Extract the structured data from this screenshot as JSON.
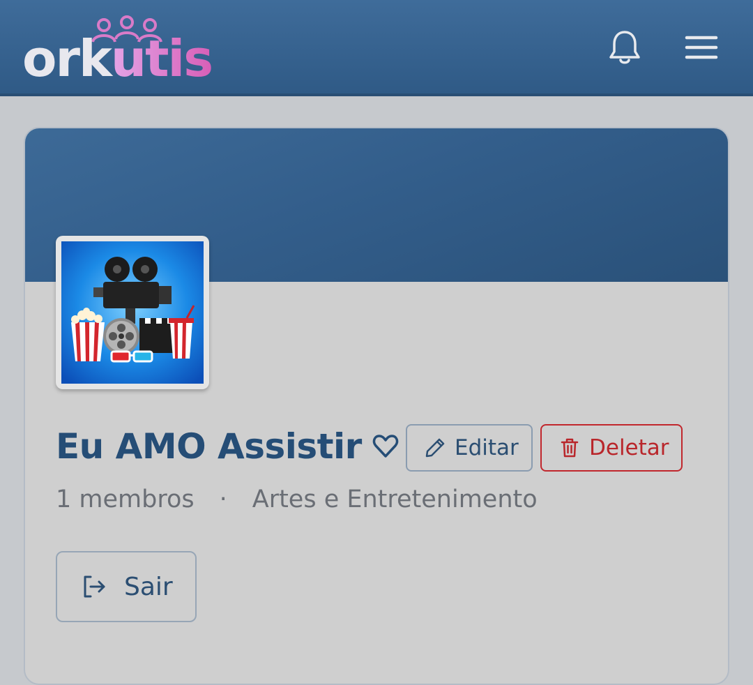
{
  "header": {
    "logo": {
      "part_a": "ork",
      "part_b": "utis"
    },
    "icons": {
      "notifications": "bell-icon",
      "menu": "hamburger-menu-icon"
    }
  },
  "group": {
    "name": "Eu AMO Assistir",
    "name_icon": "heart-outline-icon",
    "avatar_icon": "cinema-collage-image",
    "members_label": "1 membros",
    "separator": "·",
    "category": "Artes e Entretenimento"
  },
  "actions": {
    "edit_label": "Editar",
    "delete_label": "Deletar",
    "leave_label": "Sair"
  },
  "colors": {
    "header_bg": "#3a6690",
    "title": "#254d76",
    "danger": "#c1272d",
    "logo_pink": "#d75fb7",
    "page_bg": "#c6c9cd"
  }
}
